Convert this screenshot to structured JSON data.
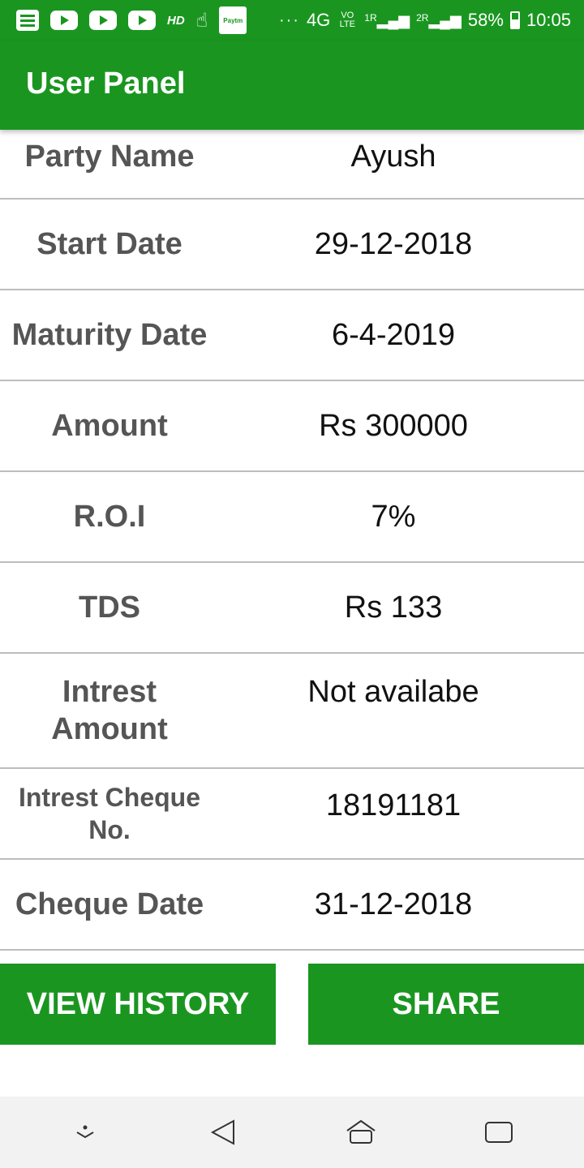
{
  "status_bar": {
    "left_icons": [
      "notes-icon",
      "youtube-icon",
      "youtube-icon",
      "youtube-icon",
      "hd-icon",
      "hand-icon",
      "paytm-icon"
    ],
    "hd_label": "HD",
    "paytm_label": "Paytm",
    "more": "···",
    "network": "4G",
    "volte": "VO LTE",
    "sim1": "1R",
    "sim2": "2R",
    "battery": "58%",
    "time": "10:05"
  },
  "app_bar": {
    "title": "User Panel"
  },
  "details": [
    {
      "label": "Party Name",
      "value": "Ayush"
    },
    {
      "label": "Start Date",
      "value": "29-12-2018"
    },
    {
      "label": "Maturity Date",
      "value": "6-4-2019"
    },
    {
      "label": "Amount",
      "value": "Rs 300000"
    },
    {
      "label": "R.O.I",
      "value": "7%"
    },
    {
      "label": "TDS",
      "value": "Rs 133"
    },
    {
      "label": "Intrest Amount",
      "value": "Not availabe"
    },
    {
      "label": "Intrest Cheque No.",
      "value": "18191181"
    },
    {
      "label": "Cheque Date",
      "value": "31-12-2018"
    }
  ],
  "buttons": {
    "view_history": "VIEW HISTORY",
    "share": "SHARE"
  },
  "nav_bar": {
    "icons": [
      "chevron-down-icon",
      "back-icon",
      "home-icon",
      "recents-icon"
    ]
  },
  "colors": {
    "primary": "#1a9620",
    "label_text": "#555555",
    "value_text": "#111111",
    "divider": "#bdbdbd"
  }
}
